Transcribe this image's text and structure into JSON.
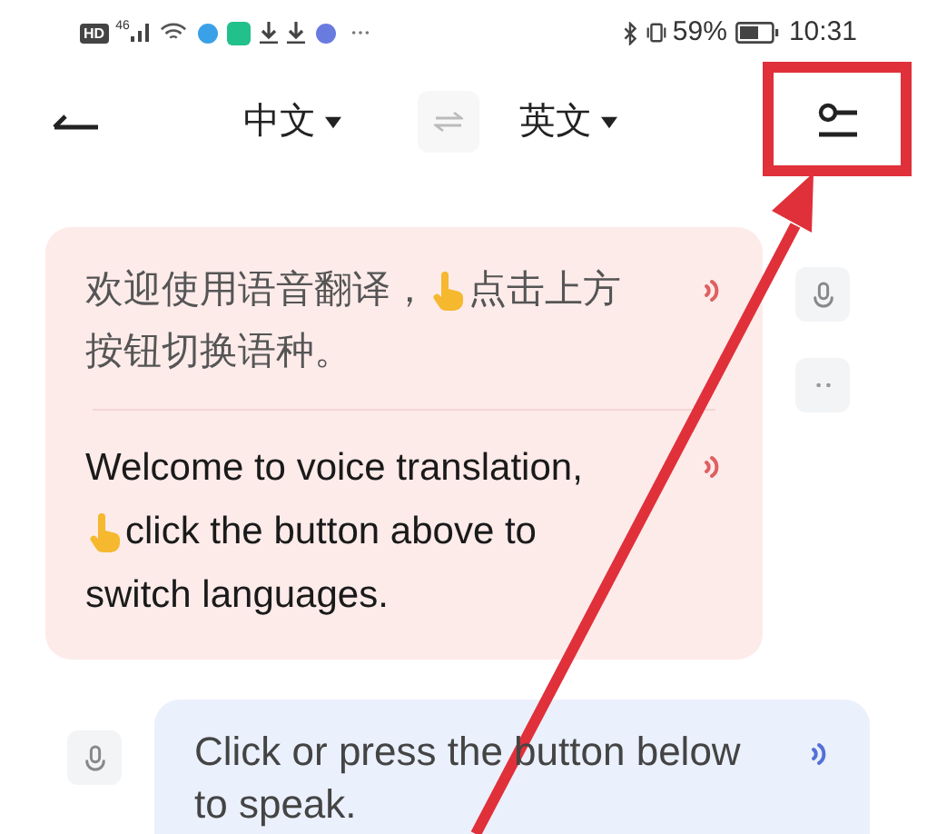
{
  "status_bar": {
    "hd": "HD",
    "network": "46",
    "battery_text": "59%",
    "time": "10:31"
  },
  "header": {
    "source_language": "中文",
    "target_language": "英文"
  },
  "messages": [
    {
      "kind": "system",
      "zh_lines": [
        [
          {
            "text": "欢迎使用语音翻译，"
          },
          {
            "text": "点击上方",
            "hand_before": true
          }
        ],
        [
          {
            "text": "按钮切换语种。"
          }
        ]
      ],
      "en_lines": [
        [
          {
            "text": "Welcome to voice translation,"
          }
        ],
        [
          {
            "text": "click the button above to",
            "hand_before": true
          }
        ],
        [
          {
            "text": "switch languages."
          }
        ]
      ]
    },
    {
      "kind": "prompt",
      "text": "Click or press the button below to speak."
    }
  ]
}
